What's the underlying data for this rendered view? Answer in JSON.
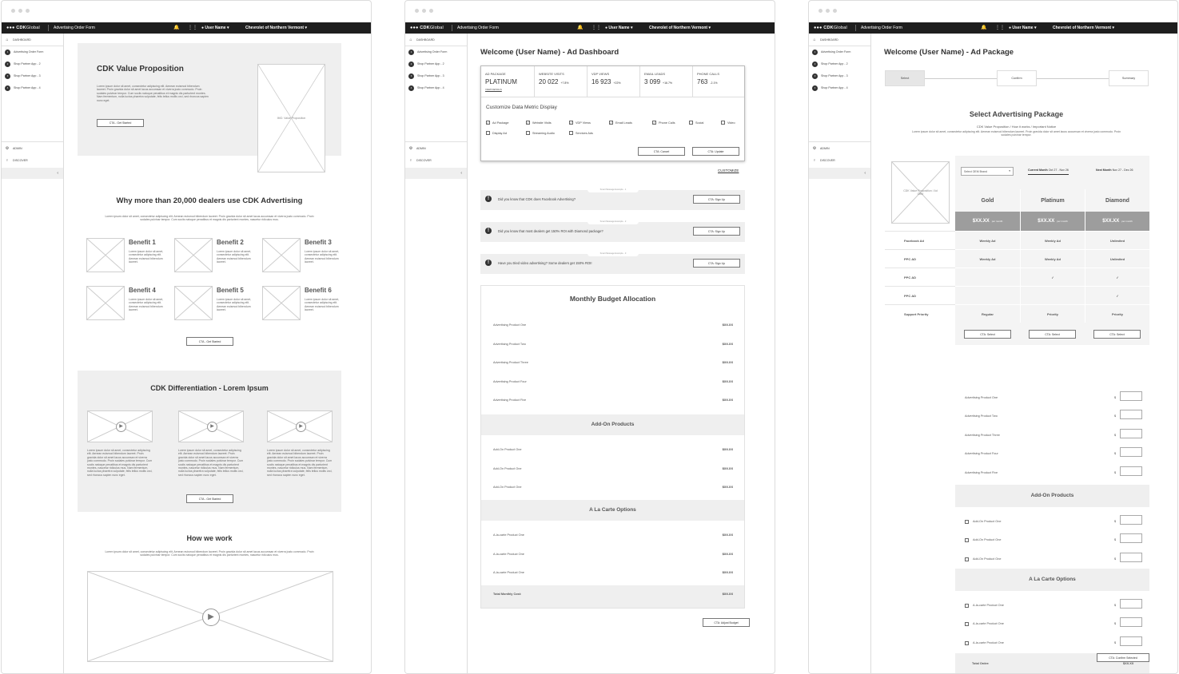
{
  "topbar": {
    "logo_a": "CDK",
    "logo_b": "Global",
    "title": "Advertising Order Form",
    "user": "User Name",
    "dealer": "Chevrolet of Northern Vermont"
  },
  "sidebar": {
    "dashboard": "DASHBOARD",
    "items": [
      {
        "num": "1",
        "label": "Advertising Order Form"
      },
      {
        "num": "2",
        "label": "Shop Partner App - 2"
      },
      {
        "num": "3",
        "label": "Shop Partner App - 3"
      },
      {
        "num": "4",
        "label": "Shop Partner App - 4"
      }
    ],
    "admin": "ADMIN",
    "discover": "DISCOVER",
    "collapse": "‹"
  },
  "p1": {
    "value_title": "CDK Value Proposition",
    "value_text": "Lorem ipsum dolor sit amet, consectetur adipiscing elit. Aenean euismod bibendum laoreet. Proin gravida dolor sit amet lacus accumsan et viverra justo commodo. Proin sodales pulvinar tempor. Cum sociis natoque penatibus et magnis dis parturient montes. Nam fermentum, nulla luctus pharetra vulputate, felis tellus mollis orci, sed rhoncus sapien nunc eget.",
    "cta_started": "CTA - Get Started",
    "img_label": "IMG: Value Proposition",
    "why_title": "Why more than 20,000 dealers use CDK Advertising",
    "why_text": "Lorem ipsum dolor sit amet, consectetur adipiscing elit. Aenean euismod bibendum laoreet. Proin gravida dolor sit amet lacus accumsan et viverra justo commodo. Proin sodales pulvinar tempor. Cum sociis natoque penatibus et magnis dis parturient montes, nascetur ridiculus mus.",
    "benefits": [
      "Benefit 1",
      "Benefit 2",
      "Benefit 3",
      "Benefit 4",
      "Benefit 5",
      "Benefit 6"
    ],
    "benefit_text": "Lorem ipsum dolor sit amet, consectetur adipiscing elit. Aenean euismod bibendum laoreet.",
    "diff_title": "CDK Differentiation - Lorem Ipsum",
    "diff_text": "Lorem ipsum dolor sit amet, consectetur adipiscing elit. Aenean euismod bibendum laoreet. Proin gravida dolor sit amet lacus accumsan et viverra justo commodo. Proin sodales pulvinar tempor. Cum sociis natoque penatibus et magnis dis parturient montes, nascetur ridiculus mus. Nam fermentum, nulla luctus pharetra vulputate, felis tellus mollis orci, sed rhoncus sapien nunc eget.",
    "how_title": "How we work",
    "how_text": "Lorem ipsum dolor sit amet, consectetur adipiscing elit. Aenean euismod bibendum laoreet. Proin gravida dolor sit amet lacus accumsan et viverra justo commodo. Proin sodales pulvinar tempor. Cum sociis natoque penatibus et magnis dis parturient montes, nascetur ridiculus mus."
  },
  "p2": {
    "title": "Welcome (User Name) - Ad Dashboard",
    "metrics": [
      {
        "label": "AD PACKAGE",
        "value": "PLATINUM",
        "delta": "",
        "sub": "VIEW DETAILS"
      },
      {
        "label": "WEBSITE VISITS",
        "value": "20 022",
        "delta": "+7.8%",
        "sub": ""
      },
      {
        "label": "VDP VIEWS",
        "value": "16 923",
        "delta": "+22%",
        "sub": ""
      },
      {
        "label": "EMAIL LEADS",
        "value": "3 099",
        "delta": "+16.7%",
        "sub": ""
      },
      {
        "label": "PHONE CALLS",
        "value": "763",
        "delta": "-2.1%",
        "sub": ""
      }
    ],
    "customize_title": "Customize Data Metric Display",
    "checks": [
      {
        "label": "Ad Package",
        "checked": true
      },
      {
        "label": "Website Visits",
        "checked": true
      },
      {
        "label": "VDP Views",
        "checked": true
      },
      {
        "label": "Email Leads",
        "checked": true
      },
      {
        "label": "Phone Calls",
        "checked": true
      },
      {
        "label": "Social",
        "checked": false
      },
      {
        "label": "Video",
        "checked": false
      },
      {
        "label": "Display Ad",
        "checked": false
      },
      {
        "label": "Streaming Audio",
        "checked": false
      },
      {
        "label": "Services Ads",
        "checked": false
      }
    ],
    "cta_cancel": "CTA: Cancel",
    "cta_update": "CTA: Update",
    "customize_link": "CUSTOMIZE",
    "messages": [
      {
        "tag": "Smart Message Example - 1",
        "text": "Did you know that CDK does Facebook Advertising?",
        "cta": "CTA: Sign Up"
      },
      {
        "tag": "Smart Message Example - 2",
        "text": "Did you know that most dealers get 150% ROI with Diamond package?",
        "cta": "CTA: Sign Up"
      },
      {
        "tag": "Smart Message Example - 3",
        "text": "Have you tried video advertising? Some dealers get 150% ROI!",
        "cta": "CTA: Sign Up"
      }
    ],
    "budget_title": "Monthly Budget Allocation",
    "products": [
      "Advertising Product One",
      "Advertising Product Two",
      "Advertising Product Three",
      "Advertising Product Four",
      "Advertising Product Five"
    ],
    "addons_title": "Add-On Products",
    "addons": [
      "Add-On Product One",
      "Add-On Product One",
      "Add-On Product One"
    ],
    "alacarte_title": "A La Carte Options",
    "alacarte": [
      "A-la-carte Product One",
      "A-la-carte Product One",
      "A-la-carte Product One"
    ],
    "price": "$XX.XX",
    "total_label": "Total Monthly Cost:",
    "cta_adjust": "CTA: Adjust Budget"
  },
  "p3": {
    "title": "Welcome (User Name) - Ad Package",
    "steps": [
      "Select",
      "Confirm",
      "Summary"
    ],
    "select_title": "Select Advertising Package",
    "select_sub": "CDK Value Proposition / How it works / Important Notice",
    "select_text": "Lorem ipsum dolor sit amet, consectetur adipiscing elit. Aenean euismod bibendum laoreet. Proin gravida dolor sit amet lacus accumsan et viverra justo commodo. Proin sodales pulvinar tempor.",
    "img_label": "CDK Value Proposition / Ad Offer",
    "oem_select": "Select OEM Brand",
    "current_month_label": "Current Month",
    "current_month": "Oct 27 - Nov 26",
    "next_month_label": "Next Month",
    "next_month": "Nov 27 - Dec 26",
    "tiers": [
      "Gold",
      "Platinum",
      "Diamond"
    ],
    "tier_price": "$XX.XX",
    "per_month": "per month",
    "features": [
      {
        "name": "Facebook Ad",
        "vals": [
          "Weekly Ad",
          "Weekly Ad",
          "Unlimited"
        ]
      },
      {
        "name": "PPC AD",
        "vals": [
          "Weekly Ad",
          "Weekly Ad",
          "Unlimited"
        ]
      },
      {
        "name": "PPC AD",
        "vals": [
          "",
          "✓",
          "✓"
        ]
      },
      {
        "name": "PPC AD",
        "vals": [
          "",
          "",
          "✓"
        ]
      },
      {
        "name": "Support Priority",
        "vals": [
          "Regular",
          "Priority",
          "Priority"
        ]
      }
    ],
    "cta_select": "CTA: Select",
    "products": [
      "Advertising Product One",
      "Advertising Product Two",
      "Advertising Product Three",
      "Advertising Product Four",
      "Advertising Product Five"
    ],
    "currency": "$",
    "addons_title": "Add-On Products",
    "addons": [
      "Add-On Product One",
      "Add-On Product One",
      "Add-On Product One"
    ],
    "alacarte_title": "A La Carte Options",
    "alacarte": [
      "A-la-carte Product One",
      "A-la-carte Product One",
      "A-la-carte Product One"
    ],
    "total_label": "Total Order:",
    "total_value": "$XX.XX",
    "cta_confirm": "CTA: Confirm Selected"
  }
}
